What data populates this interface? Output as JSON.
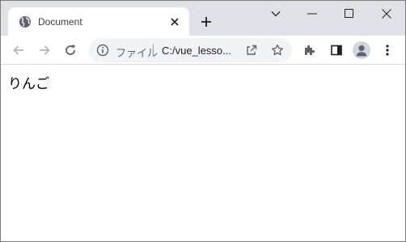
{
  "tab": {
    "title": "Document",
    "icon": "globe-icon"
  },
  "toolbar": {
    "back_icon": "arrow-left-icon",
    "forward_icon": "arrow-right-icon",
    "reload_icon": "reload-icon"
  },
  "omnibox": {
    "scheme_label": "ファイル",
    "url": "C:/vue_lesso..."
  },
  "page": {
    "text": "りんご"
  },
  "colors": {
    "tabstrip": "#dee1e6",
    "omnibox": "#f1f3f4",
    "icon": "#5f6368",
    "icon_disabled": "#b4b4b4"
  }
}
